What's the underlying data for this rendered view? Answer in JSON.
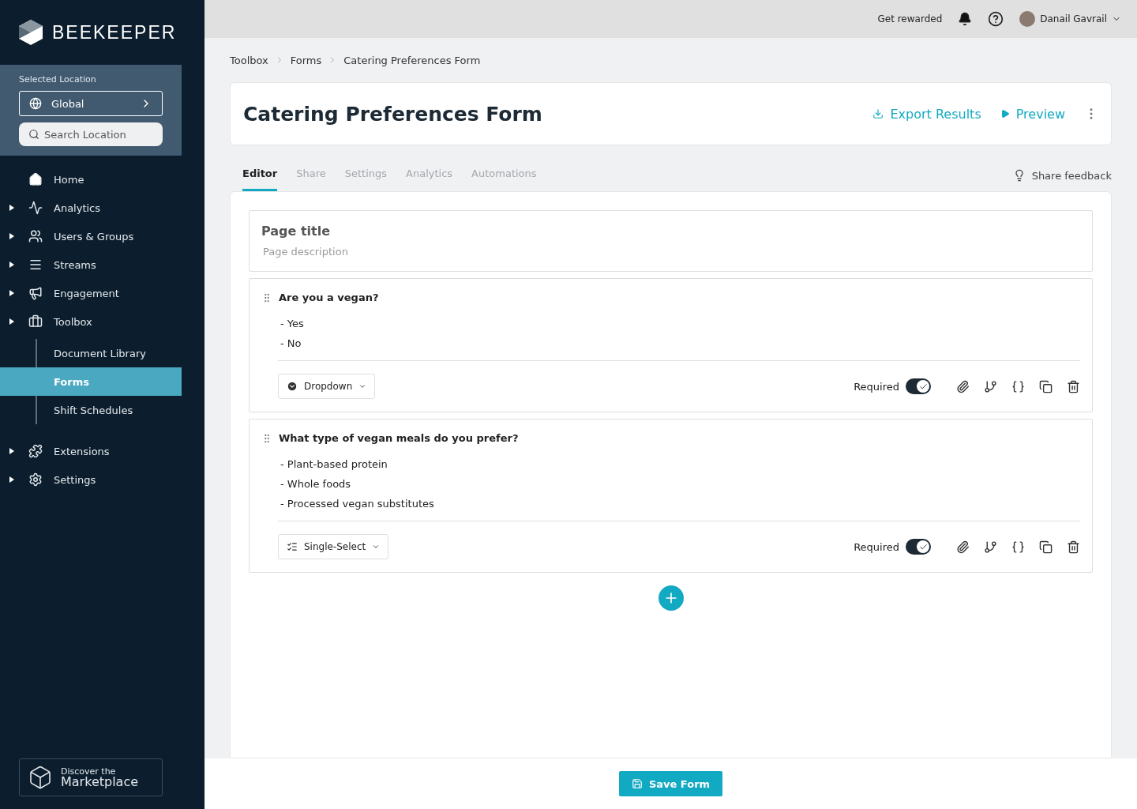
{
  "brand": {
    "name": "BEEKEEPER"
  },
  "location": {
    "label": "Selected Location",
    "value": "Global",
    "search_placeholder": "Search Location"
  },
  "sidebar": {
    "items": [
      {
        "label": "Home",
        "expandable": false,
        "selected": false
      },
      {
        "label": "Analytics",
        "expandable": true,
        "selected": false
      },
      {
        "label": "Users & Groups",
        "expandable": true,
        "selected": false
      },
      {
        "label": "Streams",
        "expandable": true,
        "selected": false
      },
      {
        "label": "Engagement",
        "expandable": true,
        "selected": false
      },
      {
        "label": "Toolbox",
        "expandable": true,
        "selected": false,
        "children": [
          {
            "label": "Document Library",
            "selected": false
          },
          {
            "label": "Forms",
            "selected": true
          },
          {
            "label": "Shift Schedules",
            "selected": false
          }
        ]
      },
      {
        "label": "Extensions",
        "expandable": true,
        "selected": false
      },
      {
        "label": "Settings",
        "expandable": true,
        "selected": false
      }
    ]
  },
  "marketplace": {
    "line_1": "Discover the",
    "line_2": "Marketplace"
  },
  "topbar": {
    "rewards": "Get rewarded",
    "user": "Danail Gavrail"
  },
  "breadcrumbs": [
    "Toolbox",
    "Forms",
    "Catering Preferences Form"
  ],
  "header": {
    "title": "Catering Preferences Form",
    "export": "Export Results",
    "preview": "Preview"
  },
  "tabs": [
    {
      "label": "Editor",
      "selected": true
    },
    {
      "label": "Share",
      "selected": false
    },
    {
      "label": "Settings",
      "selected": false
    },
    {
      "label": "Analytics",
      "selected": false
    },
    {
      "label": "Automations",
      "selected": false
    }
  ],
  "feedback": "Share feedback",
  "page": {
    "title": "Page title",
    "description_placeholder": "Page description"
  },
  "questions": [
    {
      "title": "Are you a vegan?",
      "options": [
        "- Yes",
        "- No"
      ],
      "type": {
        "kind": "dropdown",
        "label": "Dropdown"
      },
      "required_label": "Required",
      "required": true
    },
    {
      "title": "What type of vegan meals do you prefer?",
      "options": [
        "- Plant-based protein",
        "- Whole foods",
        "- Processed vegan substitutes"
      ],
      "type": {
        "kind": "single-select",
        "label": "Single-Select"
      },
      "required_label": "Required",
      "required": true
    }
  ],
  "save": "Save Form"
}
